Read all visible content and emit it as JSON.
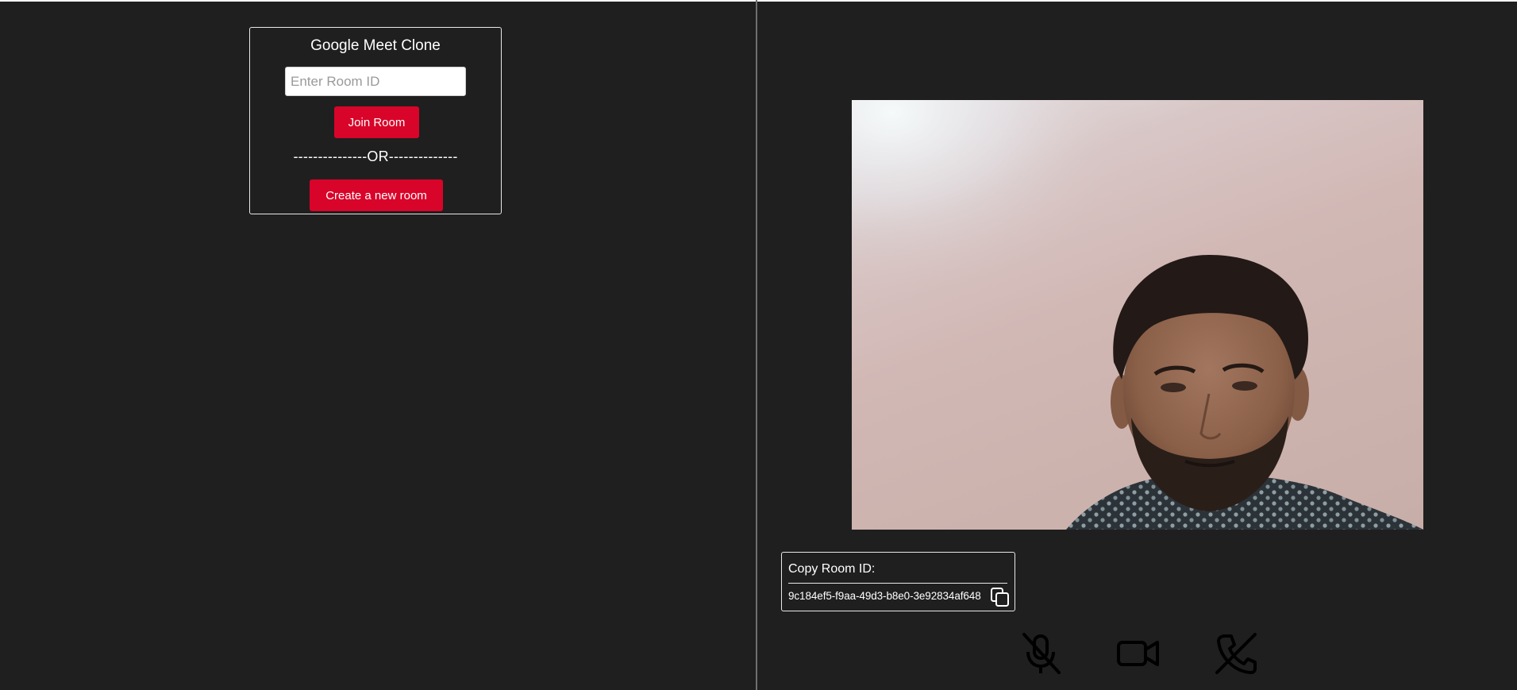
{
  "lobby": {
    "title": "Google Meet Clone",
    "room_input_placeholder": "Enter Room ID",
    "room_input_value": "",
    "join_label": "Join Room",
    "or_divider": "---------------OR--------------",
    "create_label": "Create a new room",
    "accent_color": "#d90429"
  },
  "meeting": {
    "copy_label": "Copy Room ID:",
    "room_id": "9c184ef5-f9aa-49d3-b8e0-3e92834af648",
    "controls": [
      {
        "name": "mic-muted-icon",
        "state": "muted"
      },
      {
        "name": "video-camera-icon",
        "state": "on"
      },
      {
        "name": "phone-end-icon",
        "state": "end-call"
      }
    ]
  },
  "colors": {
    "background": "#1f1f1f",
    "border": "#e8e8e8",
    "text": "#ffffff"
  }
}
